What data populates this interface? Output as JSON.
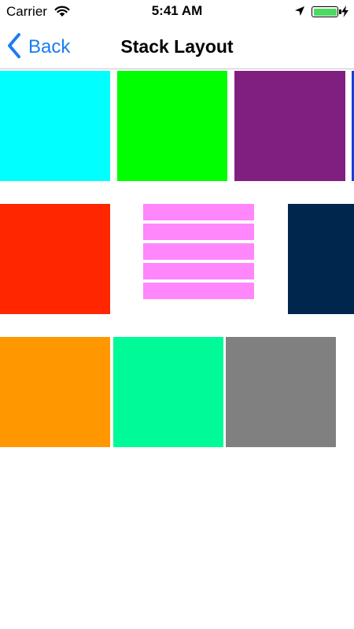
{
  "status_bar": {
    "carrier": "Carrier",
    "time": "5:41 AM",
    "battery_level": 1.0,
    "icons": [
      "wifi-icon",
      "location-arrow-icon",
      "battery-icon",
      "charging-bolt-icon"
    ]
  },
  "nav": {
    "back_label": "Back",
    "title": "Stack Layout",
    "accent_color": "#1a7cf3"
  },
  "tiles": {
    "row1": [
      "#00ffff",
      "#00ff00",
      "#801f80",
      "#1a3fd6"
    ],
    "row2": [
      "#ff2600",
      "#ff87fb",
      "#00264d"
    ],
    "row3": [
      "#ff9800",
      "#00fa98",
      "#808080"
    ]
  }
}
